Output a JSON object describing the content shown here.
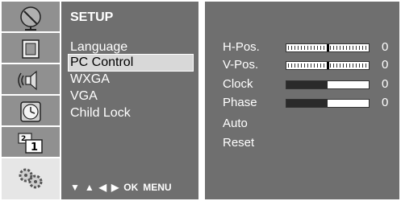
{
  "menu": {
    "title": "SETUP",
    "items": [
      {
        "label": "Language"
      },
      {
        "label": "PC Control",
        "selected": true
      },
      {
        "label": "WXGA"
      },
      {
        "label": "VGA"
      },
      {
        "label": "Child Lock"
      }
    ],
    "nav": {
      "down": "▼",
      "up": "▲",
      "left": "◀",
      "right": "▶",
      "ok": "OK",
      "menu": "MENU"
    }
  },
  "icons": [
    {
      "name": "satellite-dish-icon"
    },
    {
      "name": "picture-frame-icon"
    },
    {
      "name": "speaker-icon"
    },
    {
      "name": "clock-icon"
    },
    {
      "name": "screen-icon"
    },
    {
      "name": "gears-icon"
    }
  ],
  "adjustments": [
    {
      "label": "H-Pos.",
      "value": "0",
      "style": "ticks",
      "level": 0.5
    },
    {
      "label": "V-Pos.",
      "value": "0",
      "style": "ticks",
      "level": 0.5
    },
    {
      "label": "Clock",
      "value": "0",
      "style": "fill",
      "level": 0.5
    },
    {
      "label": "Phase",
      "value": "0",
      "style": "fill",
      "level": 0.5
    }
  ],
  "actions": [
    {
      "label": "Auto"
    },
    {
      "label": "Reset"
    }
  ],
  "colors": {
    "panel": "#6f6f6f",
    "icon_bg": "#909090",
    "selected_bg": "#d8d8d8"
  }
}
